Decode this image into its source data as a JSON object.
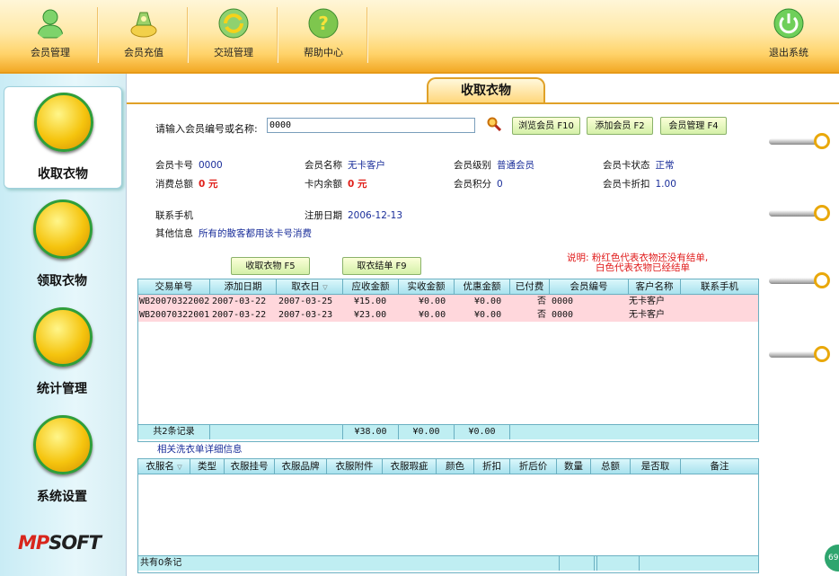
{
  "toolbar": {
    "member_mgmt": "会员管理",
    "member_recharge": "会员充值",
    "shift_mgmt": "交班管理",
    "help_center": "帮助中心",
    "exit": "退出系统"
  },
  "sidebar": {
    "items": [
      {
        "label": "收取衣物",
        "active": true
      },
      {
        "label": "领取衣物"
      },
      {
        "label": "统计管理"
      },
      {
        "label": "系统设置"
      }
    ],
    "logo_main": "MP",
    "logo_rest": "SOFT"
  },
  "page": {
    "title": "收取衣物"
  },
  "search": {
    "label": "请输入会员编号或名称:",
    "value": "0000"
  },
  "buttons": {
    "browse_member": "浏览会员 F10",
    "add_member": "添加会员 F2",
    "member_manage": "会员管理 F4",
    "receive_clothes": "收取衣物 F5",
    "collect_settle": "取衣结单 F9"
  },
  "member_info": {
    "card_no_label": "会员卡号",
    "card_no": "0000",
    "name_label": "会员名称",
    "name": "无卡客户",
    "level_label": "会员级别",
    "level": "普通会员",
    "card_status_label": "会员卡状态",
    "card_status": "正常",
    "total_spend_label": "消费总额",
    "total_spend": "0 元",
    "balance_label": "卡内余额",
    "balance": "0 元",
    "points_label": "会员积分",
    "points": "0",
    "discount_label": "会员卡折扣",
    "discount": "1.00",
    "phone_label": "联系手机",
    "phone": "",
    "reg_date_label": "注册日期",
    "reg_date": "2006-12-13",
    "other_label": "其他信息",
    "other": "所有的散客都用该卡号消费"
  },
  "note": {
    "line1": "说明: 粉红色代表衣物还没有结单,",
    "line2": "白色代表衣物已经结单"
  },
  "orders": {
    "columns": [
      "交易单号",
      "添加日期",
      "取衣日",
      "应收金额",
      "实收金额",
      "优惠金额",
      "已付费",
      "会员编号",
      "客户名称",
      "联系手机"
    ],
    "rows": [
      [
        "WB20070322002",
        "2007-03-22",
        "2007-03-25",
        "¥15.00",
        "¥0.00",
        "¥0.00",
        "否",
        "0000",
        "无卡客户",
        ""
      ],
      [
        "WB20070322001",
        "2007-03-22",
        "2007-03-23",
        "¥23.00",
        "¥0.00",
        "¥0.00",
        "否",
        "0000",
        "无卡客户",
        ""
      ]
    ],
    "footer_count": "共2条记录",
    "footer_due": "¥38.00",
    "footer_received": "¥0.00",
    "footer_discount": "¥0.00"
  },
  "detail": {
    "title": "相关洗衣单详细信息",
    "columns": [
      "衣服名",
      "类型",
      "衣服挂号",
      "衣服品牌",
      "衣服附件",
      "衣服瑕疵",
      "颜色",
      "折扣",
      "折后价",
      "数量",
      "总额",
      "是否取",
      "备注"
    ],
    "footer_count": "共有0条记"
  },
  "corner_text": "69",
  "colors": {
    "accent": "#f2a825",
    "member_value": "#1a2e9a",
    "warning": "#e01a1a",
    "unsettled_row": "#ffd7dc"
  }
}
